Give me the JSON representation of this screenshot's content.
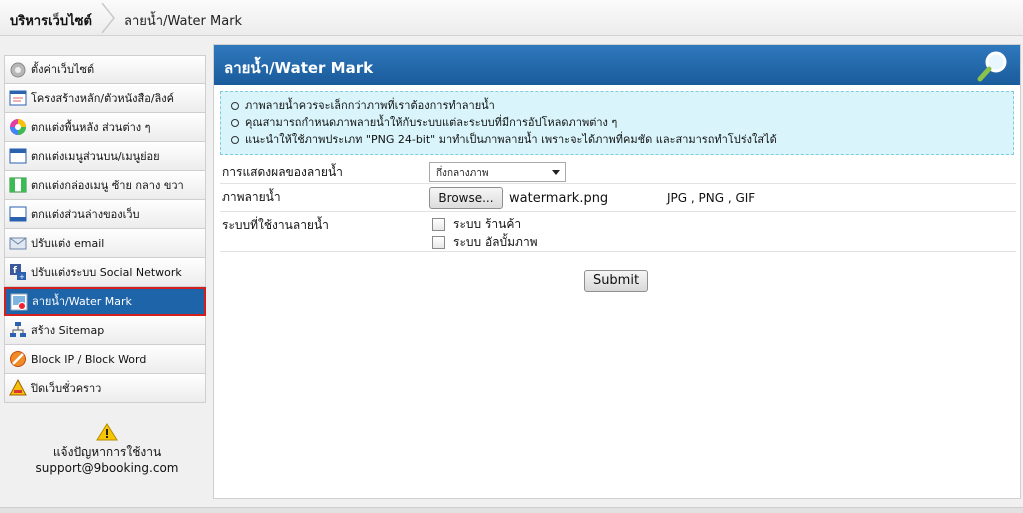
{
  "breadcrumb": {
    "home": "บริหารเว็บไซต์",
    "current": "ลายน้ำ/Water Mark"
  },
  "sidebar": {
    "items": [
      {
        "label": "ตั้งค่าเว็บไซต์",
        "icon": "gear-icon"
      },
      {
        "label": "โครงสร้างหลัก/ตัวหนังสือ/ลิงค์",
        "icon": "layout-icon"
      },
      {
        "label": "ตกแต่งพื้นหลัง ส่วนต่าง ๆ",
        "icon": "color-wheel-icon"
      },
      {
        "label": "ตกแต่งเมนูส่วนบน/เมนูย่อย",
        "icon": "top-menu-icon"
      },
      {
        "label": "ตกแต่งกล่องเมนู ซ้าย กลาง ขวา",
        "icon": "menu-box-icon"
      },
      {
        "label": "ตกแต่งส่วนล่างของเว็บ",
        "icon": "footer-icon"
      },
      {
        "label": "ปรับแต่ง email",
        "icon": "email-icon"
      },
      {
        "label": "ปรับแต่งระบบ Social Network",
        "icon": "facebook-icon"
      },
      {
        "label": "ลายน้ำ/Water Mark",
        "icon": "watermark-icon",
        "active": true
      },
      {
        "label": "สร้าง Sitemap",
        "icon": "sitemap-icon"
      },
      {
        "label": "Block IP / Block Word",
        "icon": "block-icon"
      },
      {
        "label": "ปิดเว็บชั่วคราว",
        "icon": "construction-icon"
      }
    ]
  },
  "support": {
    "title": "แจ้งปัญหาการใช้งาน",
    "email": "support@9booking.com"
  },
  "panel": {
    "title": "ลายน้ำ/Water Mark",
    "notes": [
      "ภาพลายน้ำควรจะเล็กกว่าภาพที่เราต้องการทำลายน้ำ",
      "คุณสามารถกำหนดภาพลายน้ำให้กับระบบแต่ละระบบที่มีการอัปโหลดภาพต่าง ๆ",
      "แนะนำให้ใช้ภาพประเภท \"PNG 24-bit\" มาทำเป็นภาพลายน้ำ เพราะจะได้ภาพที่คมชัด และสามารถทำโปร่งใสได้"
    ]
  },
  "form": {
    "position_label": "การแสดงผลของลายน้ำ",
    "position_value": "กึ่งกลางภาพ",
    "image_label": "ภาพลายน้ำ",
    "browse_label": "Browse...",
    "filename": "watermark.png",
    "filetypes": "JPG , PNG , GIF",
    "systems_label": "ระบบที่ใช้งานลายน้ำ",
    "system_options": [
      "ระบบ ร้านค้า",
      "ระบบ อัลบั้มภาพ"
    ],
    "submit_label": "Submit"
  },
  "colors": {
    "accent": "#1e64a8",
    "active_border": "#d41f1f",
    "notes_bg": "#d9f5fb"
  }
}
